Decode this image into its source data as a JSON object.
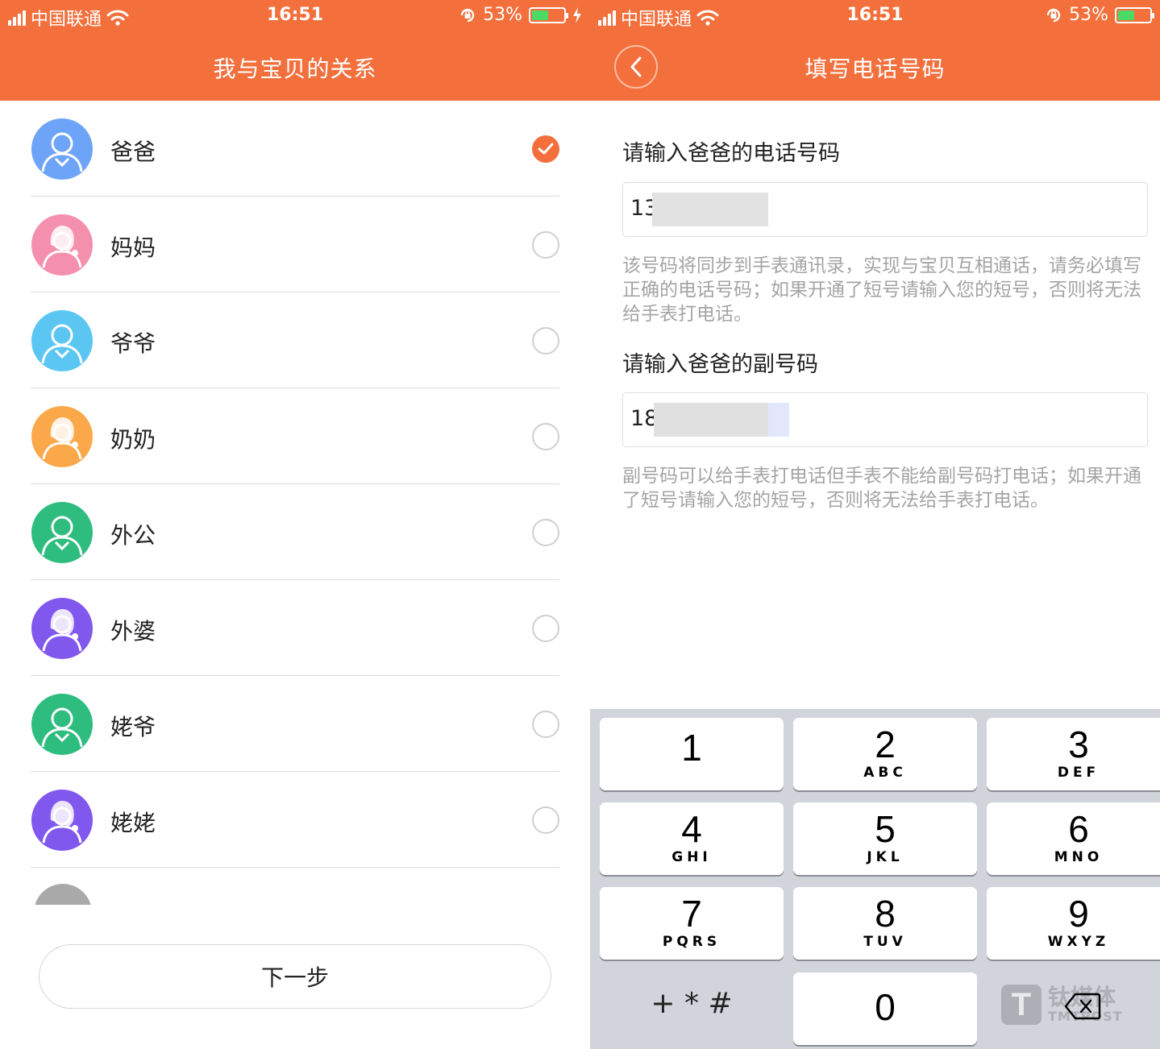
{
  "status_bar": {
    "carrier": "中国联通",
    "time": "16:51",
    "battery_percent": "53%",
    "battery_level": 0.53,
    "battery_color": "#4cd964"
  },
  "brand_color": "#f36f3c",
  "left_screen": {
    "title": "我与宝贝的关系",
    "relations": [
      {
        "label": "爸爸",
        "avatar_color": "#6ea4f7",
        "avatar_type": "male-avatar-icon",
        "selected": true
      },
      {
        "label": "妈妈",
        "avatar_color": "#f58fae",
        "avatar_type": "female-avatar-icon",
        "selected": false
      },
      {
        "label": "爷爷",
        "avatar_color": "#5cc6f3",
        "avatar_type": "male-avatar-icon",
        "selected": false
      },
      {
        "label": "奶奶",
        "avatar_color": "#fba84a",
        "avatar_type": "female-avatar-icon",
        "selected": false
      },
      {
        "label": "外公",
        "avatar_color": "#2ebd7f",
        "avatar_type": "male-avatar-icon",
        "selected": false
      },
      {
        "label": "外婆",
        "avatar_color": "#8158ee",
        "avatar_type": "female-avatar-icon",
        "selected": false
      },
      {
        "label": "姥爷",
        "avatar_color": "#2ebd7f",
        "avatar_type": "male-avatar-icon",
        "selected": false
      },
      {
        "label": "姥姥",
        "avatar_color": "#8158ee",
        "avatar_type": "female-avatar-icon",
        "selected": false
      }
    ],
    "next_button": "下一步"
  },
  "right_screen": {
    "title": "填写电话号码",
    "phone_label": "请输入爸爸的电话号码",
    "phone_value": "13",
    "phone_hint": "该号码将同步到手表通讯录，实现与宝贝互相通话，请务必填写正确的电话号码；如果开通了短号请输入您的短号，否则将无法给手表打电话。",
    "secondary_label": "请输入爸爸的副号码",
    "secondary_value": "18",
    "secondary_hint": "副号码可以给手表打电话但手表不能给副号码打电话；如果开通了短号请输入您的短号，否则将无法给手表打电话。"
  },
  "keypad": {
    "keys": [
      {
        "digit": "1",
        "letters": ""
      },
      {
        "digit": "2",
        "letters": "ABC"
      },
      {
        "digit": "3",
        "letters": "DEF"
      },
      {
        "digit": "4",
        "letters": "GHI"
      },
      {
        "digit": "5",
        "letters": "JKL"
      },
      {
        "digit": "6",
        "letters": "MNO"
      },
      {
        "digit": "7",
        "letters": "PQRS"
      },
      {
        "digit": "8",
        "letters": "TUV"
      },
      {
        "digit": "9",
        "letters": "WXYZ"
      }
    ],
    "symbols": "+ * #",
    "zero": "0"
  },
  "watermark": {
    "cn": "钛媒体",
    "en": "TMTPOST",
    "logo_letter": "T"
  }
}
